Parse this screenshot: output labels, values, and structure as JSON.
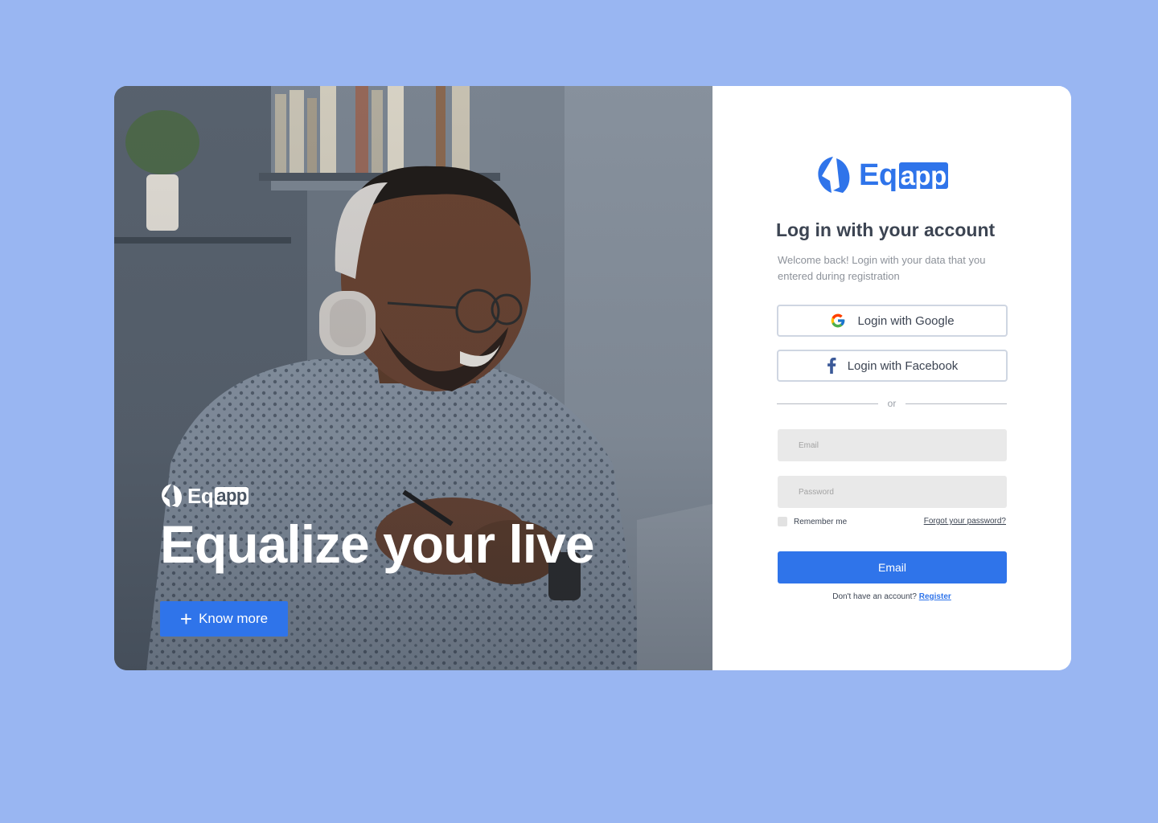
{
  "colors": {
    "page_background": "#99b6f2",
    "accent": "#2f74ea",
    "heading": "#3c4452",
    "muted": "#8d929a",
    "field_background": "#e9e9e9"
  },
  "hero": {
    "image": "man-with-headphones-photo",
    "logo": {
      "icon": "eqapp-logo-icon",
      "text_plain": "Eq",
      "text_boxed": "app"
    },
    "title": "Equalize your live",
    "button": {
      "icon": "plus-icon",
      "label": "Know more"
    }
  },
  "form": {
    "logo": {
      "icon": "eqapp-logo-icon",
      "text_plain": "Eq",
      "text_boxed": "app"
    },
    "title": "Log in with your account",
    "subtitle": "Welcome back! Login with your data that you entered during registration",
    "google_button": {
      "icon": "google-icon",
      "label": "Login with Google"
    },
    "facebook_button": {
      "icon": "facebook-icon",
      "label": "Login with Facebook"
    },
    "divider_text": "or",
    "email": {
      "placeholder": "Email",
      "value": ""
    },
    "password": {
      "placeholder": "Password",
      "value": ""
    },
    "remember_label": "Remember me",
    "forgot_link": "Forgot your password?",
    "submit_label": "Email",
    "register_prompt": "Don't have an account?",
    "register_link": "Register"
  }
}
